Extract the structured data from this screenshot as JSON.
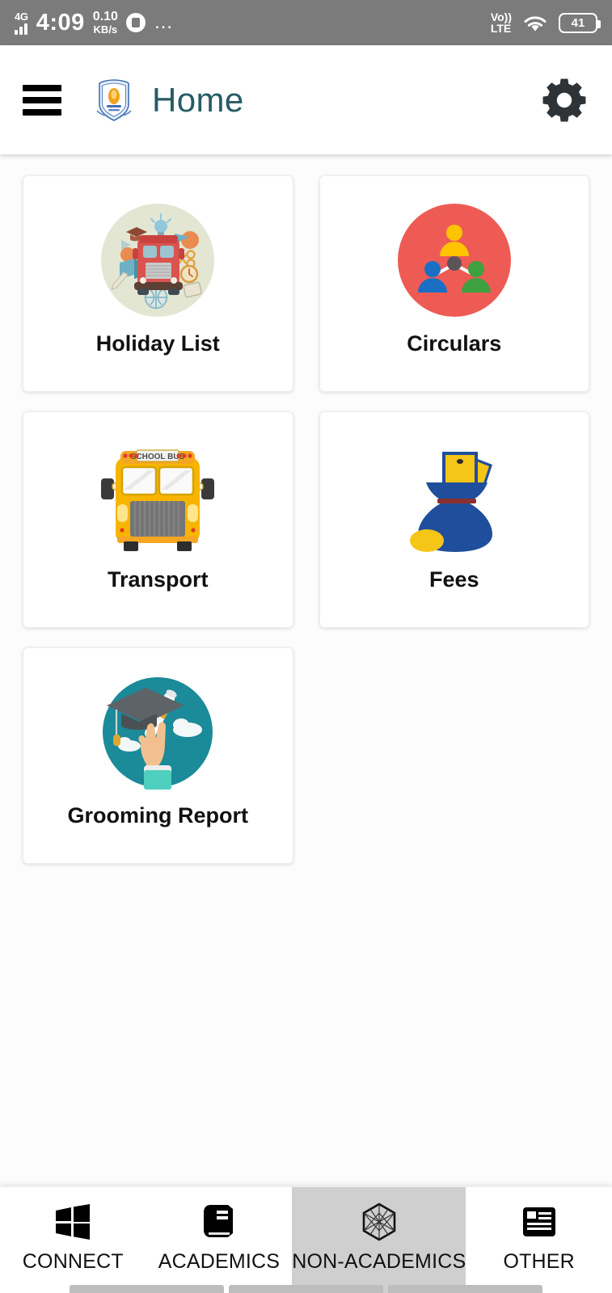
{
  "status_bar": {
    "network_gen": "4G",
    "signal_icon": "signal-bars-icon",
    "time": "4:09",
    "data_rate_value": "0.10",
    "data_rate_unit": "KB/s",
    "chrome_icon": "chrome-icon",
    "overflow_icon": "more-dots-icon",
    "volte_top": "Vo))",
    "volte_bottom": "LTE",
    "wifi_icon": "wifi-icon",
    "battery_level": "41",
    "background_color": "#7b7b7b"
  },
  "app_bar": {
    "menu_icon": "hamburger-menu-icon",
    "logo_icon": "school-crest-logo",
    "title": "Home",
    "settings_icon": "gear-icon",
    "title_color": "#275b66"
  },
  "main": {
    "cards": [
      {
        "label": "Holiday List",
        "icon": "school-bus-supplies-circle-icon",
        "accent": "#E3E6D3"
      },
      {
        "label": "Circulars",
        "icon": "people-network-circle-icon",
        "accent": "#EE5B54"
      },
      {
        "label": "Transport",
        "icon": "school-bus-front-icon",
        "accent": "#F5A623"
      },
      {
        "label": "Fees",
        "icon": "money-bag-icon",
        "accent": "#1F4E9C"
      },
      {
        "label": "Grooming Report",
        "icon": "graduation-cap-hand-circle-icon",
        "accent": "#1B8A99"
      }
    ]
  },
  "bottom_nav": {
    "items": [
      {
        "label": "CONNECT",
        "icon": "windows-grid-icon",
        "active": false
      },
      {
        "label": "ACADEMICS",
        "icon": "book-icon",
        "active": false
      },
      {
        "label": "NON-ACADEMICS",
        "icon": "hexagon-mesh-icon",
        "active": true
      },
      {
        "label": "OTHER",
        "icon": "list-view-icon",
        "active": false
      }
    ],
    "active_background": "#cfcfcf"
  }
}
